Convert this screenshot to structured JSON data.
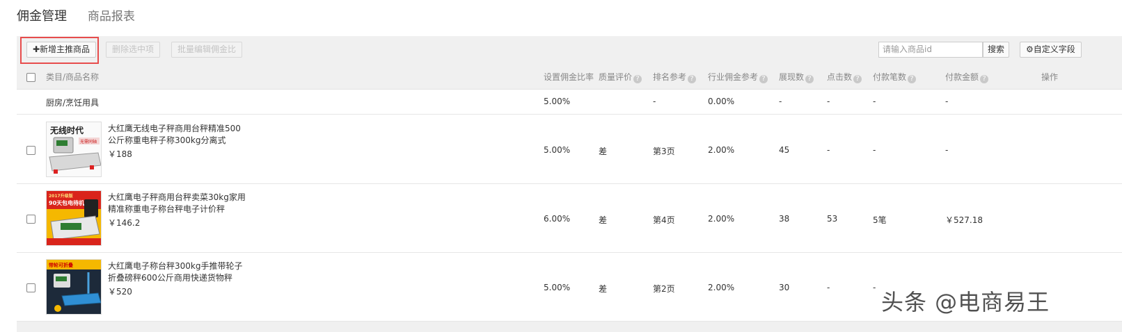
{
  "tabs": [
    "佣金管理",
    "商品报表"
  ],
  "toolbar": {
    "add_label": "✚新增主推商品",
    "delete_label": "删除选中项",
    "batch_label": "批量编辑佣金比",
    "search_placeholder": "请输入商品id",
    "search_label": "搜索",
    "custom_label": "⚙自定义字段"
  },
  "columns": {
    "name": "类目/商品名称",
    "rate": "设置佣金比率",
    "quality": "质量评价",
    "rank": "排名参考",
    "industry": "行业佣金参考",
    "views": "展现数",
    "clicks": "点击数",
    "payments": "付款笔数",
    "amount": "付款金额",
    "action": "操作"
  },
  "category_row": {
    "name": "厨房/烹饪用具",
    "rate": "5.00%",
    "rank": "-",
    "industry": "0.00%",
    "views": "-",
    "clicks": "-",
    "payments": "-",
    "amount": "-"
  },
  "products": [
    {
      "title": "大红鹰无线电子秤商用台秤精准500公斤称重电秤子称300kg分离式",
      "price": "￥188",
      "image_text": "无线时代",
      "image_sub": "无需同轴",
      "rate": "5.00%",
      "quality": "差",
      "rank": "第3页",
      "industry": "2.00%",
      "views": "45",
      "clicks": "-",
      "payments": "-",
      "amount": "-"
    },
    {
      "title": "大红鹰电子秤商用台秤卖菜30kg家用精准称重电子称台秤电子计价秤",
      "price": "￥146.2",
      "image_text": "90天包电待机",
      "image_sub": "2017升级版",
      "rate": "6.00%",
      "quality": "差",
      "rank": "第4页",
      "industry": "2.00%",
      "views": "38",
      "clicks": "53",
      "payments": "5笔",
      "amount": "￥527.18"
    },
    {
      "title": "大红鹰电子称台秤300kg手推带轮子折叠磅秤600公斤商用快递货物秤",
      "price": "￥520",
      "image_text": "带轮可折叠",
      "image_sub": "",
      "rate": "5.00%",
      "quality": "差",
      "rank": "第2页",
      "industry": "2.00%",
      "views": "30",
      "clicks": "-",
      "payments": "-",
      "amount": ""
    }
  ],
  "watermark": "头条 @电商易王",
  "colors": {
    "highlight": "#e74c4c",
    "panel_bg": "#f0f0f0",
    "accent_red": "#d9241b",
    "accent_yellow": "#f5b800"
  }
}
